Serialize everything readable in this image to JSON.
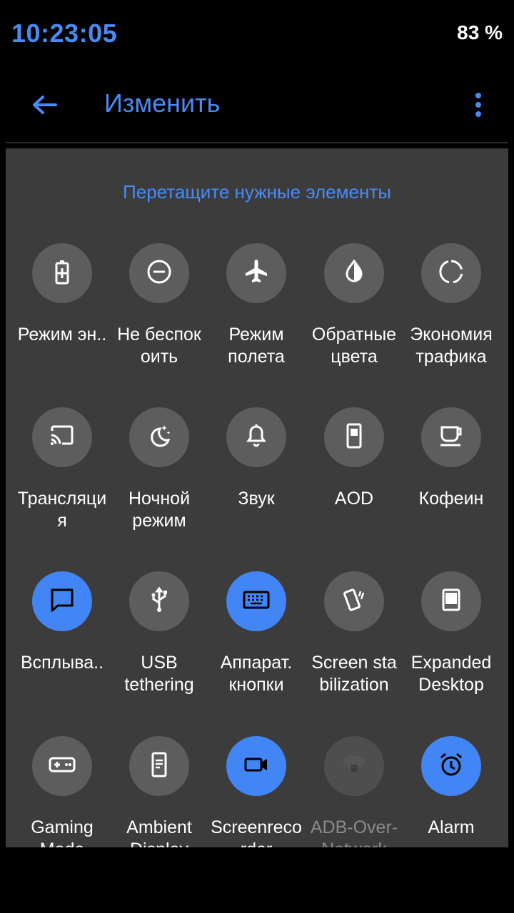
{
  "status": {
    "time": "10:23:05",
    "battery": "83 %"
  },
  "toolbar": {
    "title": "Изменить",
    "back_icon": "back-arrow-icon",
    "menu_icon": "more-vert-icon"
  },
  "panel": {
    "hint": "Перетащите нужные элементы"
  },
  "colors": {
    "accent": "#4285f4",
    "tile_off": "#5d5d5d",
    "panel_bg": "#3c3c3c"
  },
  "tiles": [
    {
      "label": "Режим эн..",
      "icon": "battery-saver-icon",
      "on": false
    },
    {
      "label": "Не беспок\nоить",
      "icon": "do-not-disturb-icon",
      "on": false
    },
    {
      "label": "Режим\nполета",
      "icon": "airplane-icon",
      "on": false
    },
    {
      "label": "Обратные\nцвета",
      "icon": "invert-colors-icon",
      "on": false
    },
    {
      "label": "Экономия\nтрафика",
      "icon": "data-saver-icon",
      "on": false
    },
    {
      "label": "Трансляци\nя",
      "icon": "cast-icon",
      "on": false
    },
    {
      "label": "Ночной\nрежим",
      "icon": "night-mode-icon",
      "on": false
    },
    {
      "label": "Звук",
      "icon": "bell-icon",
      "on": false
    },
    {
      "label": "AOD",
      "icon": "aod-phone-icon",
      "on": false
    },
    {
      "label": "Кофеин",
      "icon": "coffee-cup-icon",
      "on": false
    },
    {
      "label": "Всплыва..",
      "icon": "chat-bubble-icon",
      "on": true
    },
    {
      "label": "USB\ntethering",
      "icon": "usb-icon",
      "on": false
    },
    {
      "label": "Аппарат.\nкнопки",
      "icon": "keyboard-icon",
      "on": true
    },
    {
      "label": "Screen sta\nbilization",
      "icon": "screen-stabilization-icon",
      "on": false
    },
    {
      "label": "Expanded\nDesktop",
      "icon": "expanded-desktop-icon",
      "on": false
    },
    {
      "label": "Gaming\nMode",
      "icon": "gamepad-icon",
      "on": false
    },
    {
      "label": "Ambient\nDisplay",
      "icon": "ambient-display-icon",
      "on": false
    },
    {
      "label": "Screenreco\nrder",
      "icon": "videocam-icon",
      "on": true
    },
    {
      "label": "ADB-Over-\nNetwork",
      "icon": "adb-network-icon",
      "on": false,
      "dim": true
    },
    {
      "label": "Alarm",
      "icon": "alarm-clock-icon",
      "on": true
    }
  ]
}
